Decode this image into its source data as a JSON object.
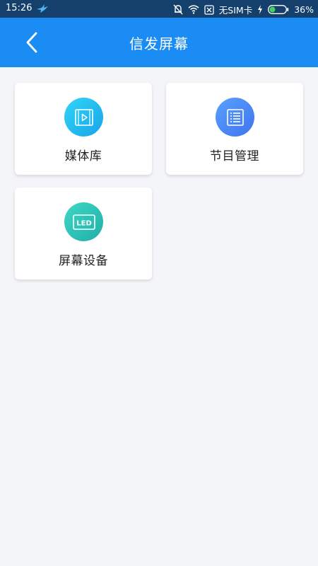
{
  "status_bar": {
    "time": "15:26",
    "carrier": "无SIM卡",
    "battery_percent": "36%",
    "battery_level": 0.36
  },
  "header": {
    "title": "信发屏幕",
    "background_color": "#1a8cf4"
  },
  "menu": {
    "items": [
      {
        "label": "媒体库",
        "icon": "video-library-icon"
      },
      {
        "label": "节目管理",
        "icon": "program-list-icon"
      },
      {
        "label": "屏幕设备",
        "icon": "led-screen-icon",
        "icon_text": "LED"
      }
    ]
  }
}
